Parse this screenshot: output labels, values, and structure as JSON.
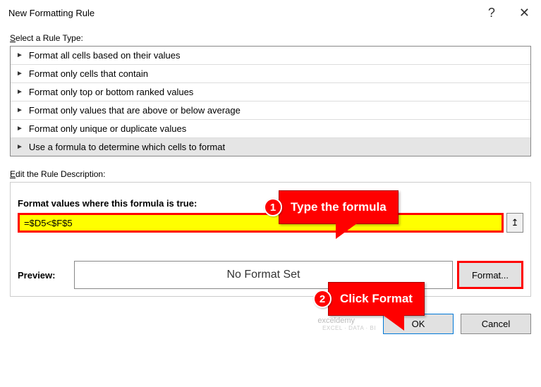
{
  "titlebar": {
    "title": "New Formatting Rule",
    "help_symbol": "?",
    "close_symbol": "✕"
  },
  "ruletype": {
    "label_pre": "S",
    "label_post": "elect a Rule Type:",
    "items": [
      "Format all cells based on their values",
      "Format only cells that contain",
      "Format only top or bottom ranked values",
      "Format only values that are above or below average",
      "Format only unique or duplicate values",
      "Use a formula to determine which cells to format"
    ],
    "selected_index": 5
  },
  "ruledesc": {
    "label_pre": "E",
    "label_post": "dit the Rule Description:",
    "formula_label": "Format values where this formula is true:",
    "formula_value": "=$D5<$F$5",
    "ref_glyph": "↥"
  },
  "preview": {
    "label": "Preview:",
    "text": "No Format Set",
    "format_btn": "Format..."
  },
  "footer": {
    "ok": "OK",
    "cancel": "Cancel",
    "watermark": "exceldemy",
    "watermark_sub": "EXCEL · DATA · BI"
  },
  "callouts": {
    "c1_num": "1",
    "c1_text": "Type the formula",
    "c2_num": "2",
    "c2_text": "Click Format"
  }
}
